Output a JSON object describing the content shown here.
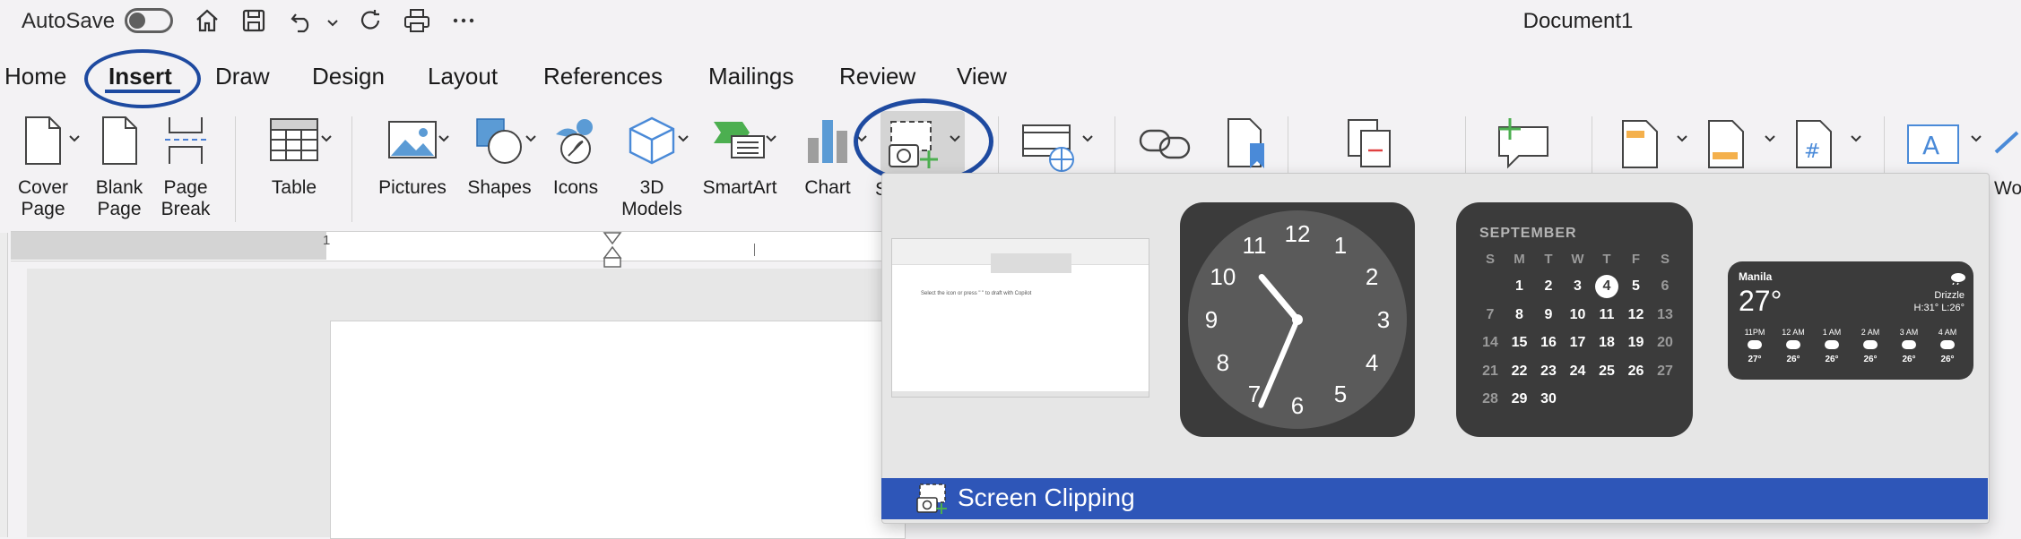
{
  "titlebar": {
    "autosave_label": "AutoSave",
    "doc_title": "Document1"
  },
  "tabs": [
    {
      "label": "Home"
    },
    {
      "label": "Insert"
    },
    {
      "label": "Draw"
    },
    {
      "label": "Design"
    },
    {
      "label": "Layout"
    },
    {
      "label": "References"
    },
    {
      "label": "Mailings"
    },
    {
      "label": "Review"
    },
    {
      "label": "View"
    }
  ],
  "ribbon": {
    "cover_page": [
      "Cover",
      "Page"
    ],
    "blank_page": [
      "Blank",
      "Page"
    ],
    "page_break": [
      "Page",
      "Break"
    ],
    "table": "Table",
    "pictures": "Pictures",
    "shapes": "Shapes",
    "icons": "Icons",
    "models": [
      "3D",
      "Models"
    ],
    "smartart": "SmartArt",
    "chart": "Chart",
    "screenshot_partial": "S",
    "wordart_partial": "Wo"
  },
  "ruler": {
    "marker": "1"
  },
  "screenshot_menu": {
    "thumbnail_doc_text": "Select the icon or press \" \" to draft with Copilot",
    "calendar": {
      "month": "SEPTEMBER",
      "weekdays": [
        "S",
        "M",
        "T",
        "W",
        "T",
        "F",
        "S"
      ],
      "rows": [
        [
          "",
          "1",
          "2",
          "3",
          "4",
          "5",
          "6"
        ],
        [
          "7",
          "8",
          "9",
          "10",
          "11",
          "12",
          "13"
        ],
        [
          "14",
          "15",
          "16",
          "17",
          "18",
          "19",
          "20"
        ],
        [
          "21",
          "22",
          "23",
          "24",
          "25",
          "26",
          "27"
        ],
        [
          "28",
          "29",
          "30",
          "",
          "",
          "",
          ""
        ]
      ],
      "today": "4"
    },
    "clock_numbers": [
      "12",
      "1",
      "2",
      "3",
      "4",
      "5",
      "6",
      "7",
      "8",
      "9",
      "10",
      "11"
    ],
    "weather": {
      "city": "Manila",
      "temp": "27°",
      "condition": "Drizzle",
      "hilo": "H:31° L:26°",
      "hours": [
        "11PM",
        "12 AM",
        "1 AM",
        "2 AM",
        "3 AM",
        "4 AM"
      ],
      "temps": [
        "27°",
        "26°",
        "26°",
        "26°",
        "26°",
        "26°"
      ]
    },
    "screen_clipping": "Screen Clipping"
  },
  "colors": {
    "accent": "#2e56b8",
    "annotation": "#1e4aa0"
  }
}
